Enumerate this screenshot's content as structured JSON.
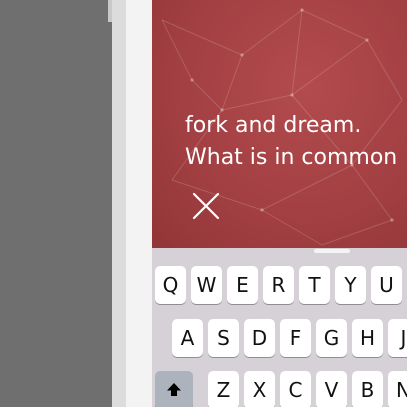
{
  "prompt": {
    "line1": "fork and dream.",
    "line2": "What is in common"
  },
  "icons": {
    "close": "close-icon",
    "shift": "shift-icon"
  },
  "colors": {
    "hero_background": "#a34043",
    "keyboard_background": "#d5d1d7",
    "key_background": "#ffffff",
    "shift_key_background": "#adb3bc"
  },
  "keyboard": {
    "row1": [
      "Q",
      "W",
      "E",
      "R",
      "T",
      "Y",
      "U"
    ],
    "row2": [
      "A",
      "S",
      "D",
      "F",
      "G",
      "H",
      "J"
    ],
    "row3": [
      "Z",
      "X",
      "C",
      "V",
      "B",
      "N"
    ]
  }
}
